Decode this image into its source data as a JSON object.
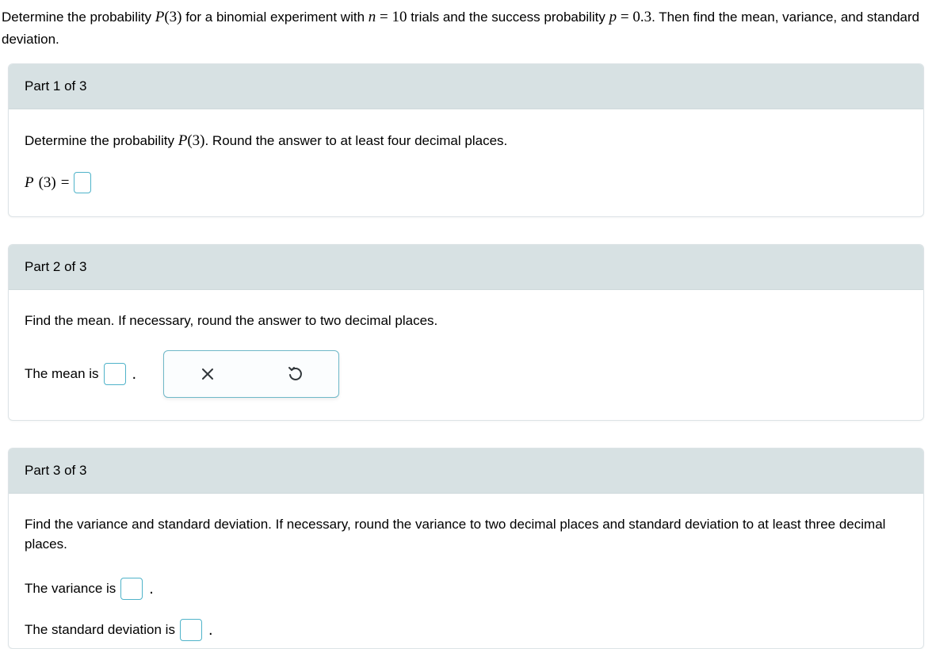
{
  "intro": {
    "prefix": "Determine the probability ",
    "P_lhs": "P",
    "P_arg": "(3)",
    "mid1": " for a binomial experiment with ",
    "n_var": "n",
    "eq1": " = ",
    "n_val": "10",
    "mid2": " trials and the success probability ",
    "p_var": "p",
    "eq2": " = ",
    "p_val": "0.3",
    "suffix": ". Then find the mean, variance, and standard deviation."
  },
  "part1": {
    "header": "Part 1 of 3",
    "prompt_pre": "Determine the probability ",
    "prompt_P": "P",
    "prompt_arg": "(3)",
    "prompt_post": ". Round the answer to at least four decimal places.",
    "lhs_P": "P",
    "lhs_arg": "(3)",
    "lhs_eq": " = "
  },
  "part2": {
    "header": "Part 2 of 3",
    "prompt": "Find the mean. If necessary, round the answer to two decimal places.",
    "label": "The mean is "
  },
  "part3": {
    "header": "Part 3 of 3",
    "prompt": "Find the variance and standard deviation. If necessary, round the variance to two decimal places and standard deviation to at least three decimal places.",
    "variance_label": "The variance is ",
    "stddev_label": "The standard deviation is "
  },
  "icons": {
    "close": "close-icon",
    "undo": "undo-icon"
  }
}
